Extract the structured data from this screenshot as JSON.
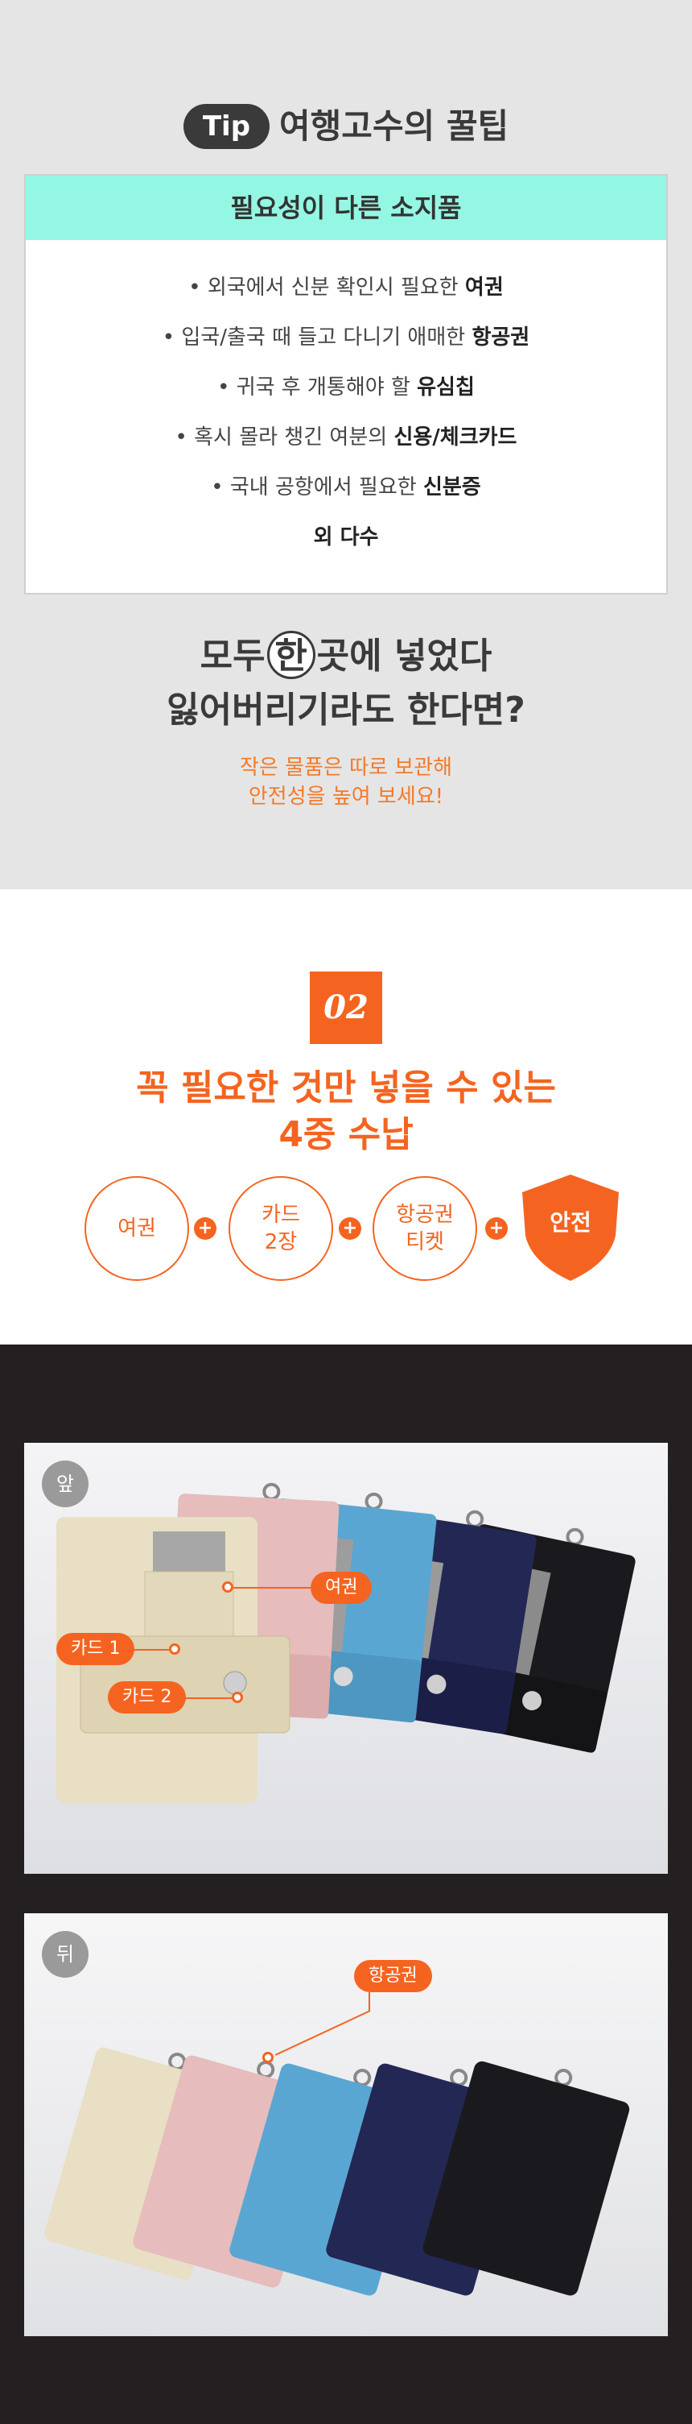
{
  "tip": {
    "badge": "Tip",
    "title": "여행고수의 꿀팁",
    "box_title": "필요성이 다른 소지품",
    "items": [
      {
        "text": "• 외국에서 신분 확인시 필요한 ",
        "bold": "여권"
      },
      {
        "text": "• 입국/출국 때 들고 다니기 애매한 ",
        "bold": "항공권"
      },
      {
        "text": "• 귀국 후 개통해야 할 ",
        "bold": "유심칩"
      },
      {
        "text": "• 혹시 몰라 챙긴 여분의 ",
        "bold": "신용/체크카드"
      },
      {
        "text": "• 국내 공항에서 필요한 ",
        "bold": "신분증"
      }
    ],
    "last": "외 다수"
  },
  "headline": {
    "line1_pre": "모두",
    "line1_circle": "한",
    "line1_post": "곳에 넣었다",
    "line2": "잃어버리기라도 한다면?"
  },
  "sub": {
    "line1": "작은 물품은 따로 보관해",
    "line2": "안전성을 높여 보세요!"
  },
  "sec2": {
    "number": "02",
    "title1": "꼭 필요한 것만 넣을 수 있는",
    "title2": "4중 수납",
    "circles": [
      "여권",
      "카드\n2장",
      "항공권\n티켓"
    ],
    "plus": "+",
    "shield": "안전"
  },
  "photos": {
    "front_label": "앞",
    "back_label": "뒤",
    "front_callouts": {
      "passport": "여권",
      "card1": "카드 1",
      "card2": "카드 2"
    },
    "back_callouts": {
      "ticket": "항공권"
    }
  },
  "colors": {
    "accent": "#f46420",
    "mint": "#94f7e3",
    "dark": "#242021",
    "gray_bg": "#e5e5e5",
    "wallets": [
      "#e8dfc4",
      "#e6bcbc",
      "#5aa6d2",
      "#232754",
      "#1a1a1e"
    ]
  }
}
